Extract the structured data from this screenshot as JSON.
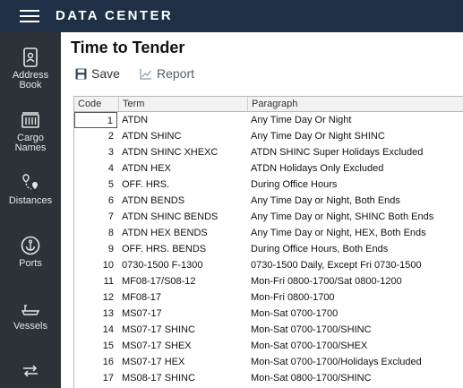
{
  "app": {
    "title": "DATA CENTER"
  },
  "sidebar": {
    "items": [
      {
        "label_1": "Address",
        "label_2": "Book",
        "icon": "address-book-icon"
      },
      {
        "label_1": "Cargo",
        "label_2": "Names",
        "icon": "cargo-icon"
      },
      {
        "label_1": "Distances",
        "icon": "distances-icon"
      },
      {
        "label_1": "Ports",
        "icon": "anchor-icon"
      },
      {
        "label_1": "Vessels",
        "icon": "ship-icon"
      },
      {
        "icon": "exchange-icon"
      }
    ]
  },
  "page": {
    "title": "Time to Tender"
  },
  "toolbar": {
    "save_label": "Save",
    "report_label": "Report"
  },
  "table": {
    "columns": [
      "Code",
      "Term",
      "Paragraph"
    ],
    "rows": [
      {
        "code": "1",
        "term": "ATDN",
        "paragraph": "Any Time Day Or Night"
      },
      {
        "code": "2",
        "term": "ATDN SHINC",
        "paragraph": "Any Time Day Or Night SHINC"
      },
      {
        "code": "3",
        "term": "ATDN SHINC XHEXC",
        "paragraph": "ATDN SHINC Super Holidays Excluded"
      },
      {
        "code": "4",
        "term": "ATDN HEX",
        "paragraph": "ATDN Holidays Only Excluded"
      },
      {
        "code": "5",
        "term": "OFF. HRS.",
        "paragraph": "During Office Hours"
      },
      {
        "code": "6",
        "term": "ATDN BENDS",
        "paragraph": "Any Time Day or Night, Both Ends"
      },
      {
        "code": "7",
        "term": "ATDN SHINC BENDS",
        "paragraph": "Any Time Day or Night, SHINC Both Ends"
      },
      {
        "code": "8",
        "term": "ATDN HEX BENDS",
        "paragraph": "Any Time Day or Night, HEX, Both Ends"
      },
      {
        "code": "9",
        "term": "OFF. HRS. BENDS",
        "paragraph": "During Office Hours, Both Ends"
      },
      {
        "code": "10",
        "term": "0730-1500 F-1300",
        "paragraph": "0730-1500 Daily, Except Fri 0730-1500"
      },
      {
        "code": "11",
        "term": "MF08-17/S08-12",
        "paragraph": "Mon-Fri 0800-1700/Sat 0800-1200"
      },
      {
        "code": "12",
        "term": "MF08-17",
        "paragraph": "Mon-Fri 0800-1700"
      },
      {
        "code": "13",
        "term": "MS07-17",
        "paragraph": "Mon-Sat 0700-1700"
      },
      {
        "code": "14",
        "term": "MS07-17 SHINC",
        "paragraph": "Mon-Sat 0700-1700/SHINC"
      },
      {
        "code": "15",
        "term": "MS07-17 SHEX",
        "paragraph": "Mon-Sat 0700-1700/SHEX"
      },
      {
        "code": "16",
        "term": "MS07-17 HEX",
        "paragraph": "Mon-Sat 0700-1700/Holidays Excluded"
      },
      {
        "code": "17",
        "term": "MS08-17 SHINC",
        "paragraph": "Mon-Sat 0800-1700/SHINC"
      }
    ]
  },
  "colors": {
    "topbar": "#1f2f45",
    "sidebar": "#2d3238",
    "sidebar_text": "#e6e6e6"
  }
}
